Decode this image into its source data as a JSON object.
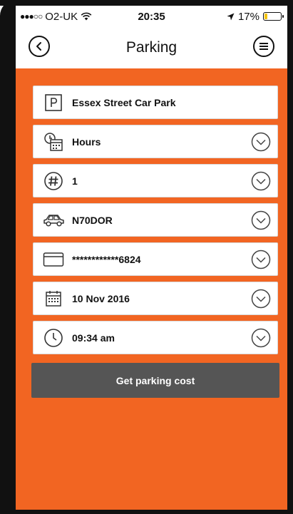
{
  "status_bar": {
    "signal": "●●●○○",
    "carrier": "O2-UK",
    "time": "20:35",
    "battery_text": "17%",
    "battery_level": 0.17,
    "battery_color": "#f4c40f"
  },
  "nav": {
    "title": "Parking",
    "back_icon": "back-circle-icon",
    "menu_icon": "menu-circle-icon"
  },
  "form": {
    "car_park": "Essex Street Car Park",
    "duration_unit": "Hours",
    "duration_value": "1",
    "vehicle_reg": "N70DOR",
    "card_number": "************6824",
    "date": "10 Nov 2016",
    "time": "09:34 am"
  },
  "actions": {
    "get_cost_label": "Get parking cost"
  },
  "colors": {
    "accent": "#f26522",
    "button": "#555555"
  }
}
